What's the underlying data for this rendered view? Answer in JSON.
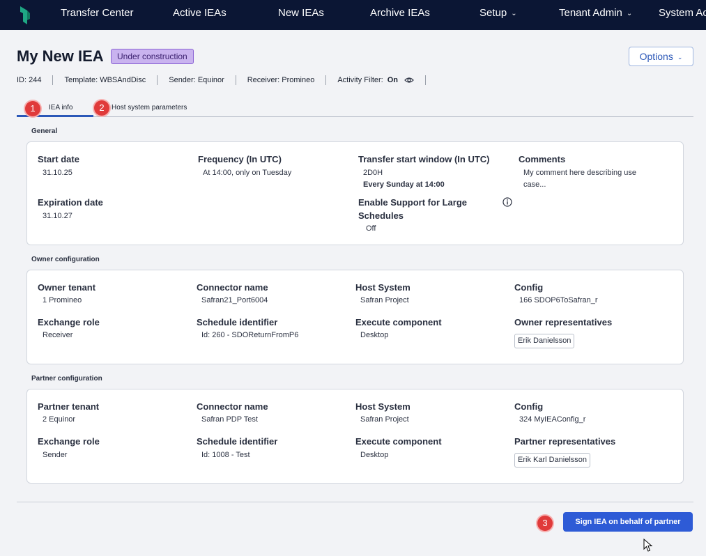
{
  "nav": {
    "items": [
      {
        "label": "Transfer Center"
      },
      {
        "label": "Active IEAs"
      },
      {
        "label": "New IEAs"
      },
      {
        "label": "Archive IEAs"
      },
      {
        "label": "Setup"
      },
      {
        "label": "Tenant Admin"
      },
      {
        "label": "System Ac"
      }
    ]
  },
  "page": {
    "title": "My New IEA",
    "status_badge": "Under construction",
    "options_label": "Options"
  },
  "meta": {
    "id": "ID: 244",
    "template": "Template: WBSAndDisc",
    "sender": "Sender: Equinor",
    "receiver": "Receiver: Promineo",
    "activity_filter_label": "Activity Filter:",
    "activity_filter_value": "On"
  },
  "tabs": [
    {
      "label": "IEA info",
      "step": "1"
    },
    {
      "label": "Host system parameters",
      "step": "2"
    }
  ],
  "general": {
    "section": "General",
    "start_date_label": "Start date",
    "start_date": "31.10.25",
    "frequency_label": "Frequency (In UTC)",
    "frequency": "At 14:00, only on Tuesday",
    "transfer_window_label": "Transfer start window (In UTC)",
    "transfer_window": "2D0H",
    "transfer_window_note": "Every Sunday at 14:00",
    "comments_label": "Comments",
    "comments_line1": "My comment here describing use",
    "comments_line2": "case...",
    "expiration_label": "Expiration date",
    "expiration": "31.10.27",
    "large_schedules_label_1": "Enable Support for Large",
    "large_schedules_label_2": "Schedules",
    "large_schedules": "Off"
  },
  "owner": {
    "section": "Owner configuration",
    "tenant_label": "Owner tenant",
    "tenant": "1 Promineo",
    "connector_label": "Connector name",
    "connector": "Safran21_Port6004",
    "host_label": "Host System",
    "host": "Safran Project",
    "config_label": "Config",
    "config": "166 SDOP6ToSafran_r",
    "role_label": "Exchange role",
    "role": "Receiver",
    "schedule_label": "Schedule identifier",
    "schedule": "Id: 260 - SDOReturnFromP6",
    "execute_label": "Execute component",
    "execute": "Desktop",
    "reps_label": "Owner representatives",
    "reps": "Erik Danielsson"
  },
  "partner": {
    "section": "Partner configuration",
    "tenant_label": "Partner tenant",
    "tenant": "2 Equinor",
    "connector_label": "Connector name",
    "connector": "Safran PDP Test",
    "host_label": "Host System",
    "host": "Safran Project",
    "config_label": "Config",
    "config": "324 MyIEAConfig_r",
    "role_label": "Exchange role",
    "role": "Sender",
    "schedule_label": "Schedule identifier",
    "schedule": "Id: 1008 - Test",
    "execute_label": "Execute component",
    "execute": "Desktop",
    "reps_label": "Partner representatives",
    "reps": "Erik Karl Danielsson"
  },
  "footer": {
    "sign_label": "Sign IEA on behalf of partner",
    "step": "3"
  },
  "colors": {
    "nav_bg": "#0b1634",
    "accent": "#2e5bd6",
    "badge_bg": "#c9b3ef",
    "step_marker": "#e03a3a"
  }
}
